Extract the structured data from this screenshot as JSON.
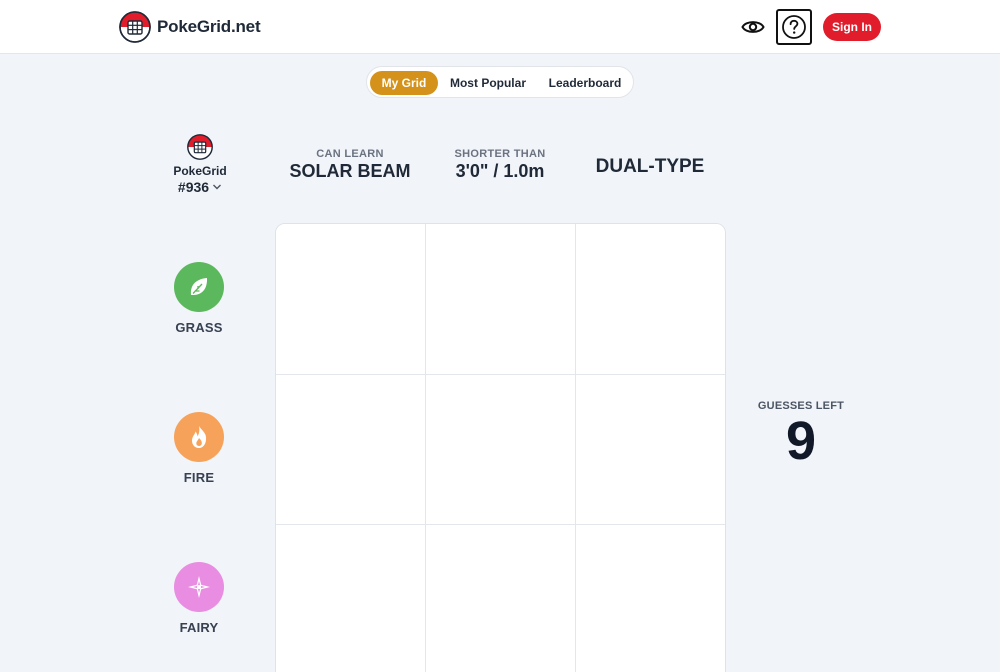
{
  "header": {
    "brand_name": "PokeGrid.net",
    "signin_label": "Sign In",
    "colors": {
      "accent": "#e11d2b"
    }
  },
  "tabs": [
    {
      "label": "My Grid",
      "active": true
    },
    {
      "label": "Most Popular",
      "active": false
    },
    {
      "label": "Leaderboard",
      "active": false
    }
  ],
  "puzzle": {
    "name": "PokeGrid",
    "number": "#936"
  },
  "columns": [
    {
      "top": "CAN LEARN",
      "main": "SOLAR BEAM"
    },
    {
      "top": "SHORTER THAN",
      "main": "3'0\" / 1.0m"
    },
    {
      "top": "",
      "main": "DUAL-TYPE"
    }
  ],
  "rows": [
    {
      "label": "GRASS",
      "icon": "leaf-icon",
      "color": "#5cb85c"
    },
    {
      "label": "FIRE",
      "icon": "flame-icon",
      "color": "#f7a25a"
    },
    {
      "label": "FAIRY",
      "icon": "sparkle-icon",
      "color": "#e88de1"
    }
  ],
  "guesses": {
    "label": "GUESSES LEFT",
    "count": "9"
  }
}
